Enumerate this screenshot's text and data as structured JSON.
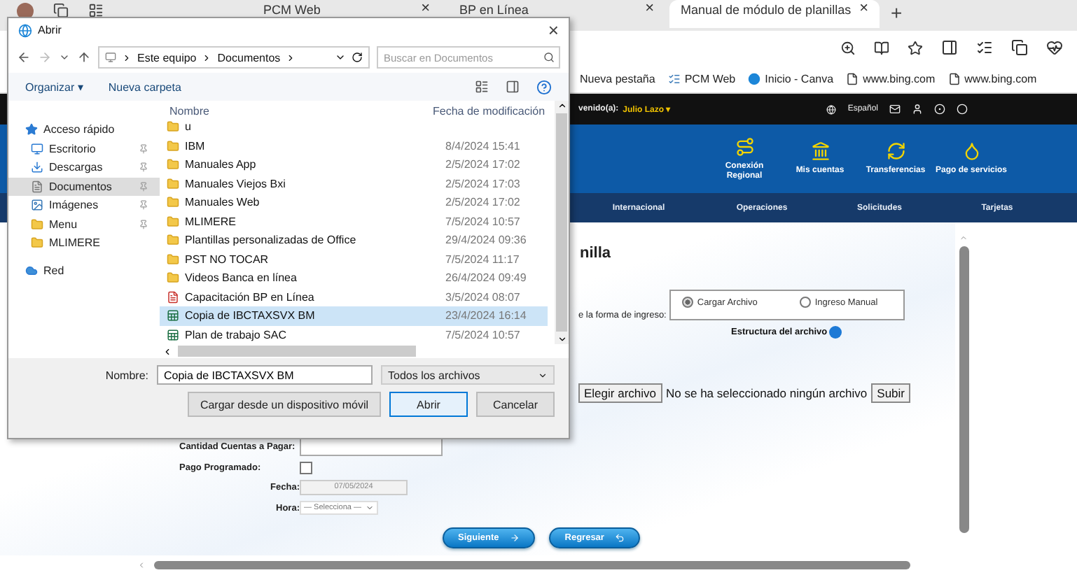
{
  "browser": {
    "tabs": [
      {
        "label": "PCM Web",
        "close": "×",
        "selected": false
      },
      {
        "label": "BP en Línea",
        "close": "×",
        "selected": false
      },
      {
        "label": "Manual de módulo de planillas",
        "close": "×",
        "selected": true
      }
    ],
    "new_tab": "+",
    "bookmarks": [
      {
        "label": "Nueva pestaña",
        "kind": "plain"
      },
      {
        "label": "PCM Web",
        "kind": "chart"
      },
      {
        "label": "Inicio - Canva",
        "kind": "round"
      },
      {
        "label": "www.bing.com",
        "kind": "page"
      },
      {
        "label": "www.bing.com",
        "kind": "page"
      }
    ]
  },
  "bank": {
    "welcome": "venido(a):",
    "user": "Julio Lazo ▾",
    "language": "Español",
    "menu": [
      "Conexión Regional",
      "Mis cuentas",
      "Transferencias",
      "Pago de servicios"
    ],
    "nav": [
      "Internacional",
      "Operaciones",
      "Solicitudes",
      "Tarjetas"
    ],
    "title": "nilla",
    "mode_label": "e la forma de ingreso:",
    "modes": [
      {
        "label": "Cargar Archivo",
        "selected": true
      },
      {
        "label": "Ingreso Manual",
        "selected": false
      }
    ],
    "structure_label": "Estructura del archivo",
    "file_button": "Elegir archivo",
    "file_status": "No se ha seleccionado ningún archivo",
    "upload_button": "Subir",
    "fields": [
      {
        "kind": "text",
        "label": "Cantidad Cuentas a Pagar:"
      },
      {
        "kind": "checkbox",
        "label": "Pago Programado:",
        "checked": false
      },
      {
        "kind": "date",
        "label": "Fecha:",
        "value": "07/05/2024",
        "disabled": true
      },
      {
        "kind": "select",
        "label": "Hora:",
        "value": "— Selecciona —"
      }
    ],
    "next_button": "Siguiente",
    "back_button": "Regresar"
  },
  "dialog": {
    "title": "Abrir",
    "close": "×",
    "path": [
      "Este equipo",
      "Documentos"
    ],
    "search_placeholder": "Buscar en Documentos",
    "organize": "Organizar ▾",
    "new_folder": "Nueva carpeta",
    "sidebar": [
      {
        "label": "Acceso rápido",
        "kind": "star",
        "pinned": false,
        "selected": false
      },
      {
        "label": "Escritorio",
        "kind": "desktop",
        "pinned": true,
        "selected": false
      },
      {
        "label": "Descargas",
        "kind": "download",
        "pinned": true,
        "selected": false
      },
      {
        "label": "Documentos",
        "kind": "document",
        "pinned": true,
        "selected": true
      },
      {
        "label": "Imágenes",
        "kind": "image",
        "pinned": true,
        "selected": false
      },
      {
        "label": "Menu",
        "kind": "folder",
        "pinned": true,
        "selected": false
      },
      {
        "label": "MLIMERE",
        "kind": "folder",
        "pinned": false,
        "selected": false
      },
      {
        "label": "Red",
        "kind": "network",
        "pinned": false,
        "selected": false
      }
    ],
    "columns": [
      "Nombre",
      "Fecha de modificación"
    ],
    "files": [
      {
        "name": "u",
        "kind": "folder",
        "selected": false
      },
      {
        "name": "IBM",
        "date": "8/4/2024 15:41",
        "kind": "folder",
        "selected": false
      },
      {
        "name": "Manuales App",
        "date": "2/5/2024 17:02",
        "kind": "folder",
        "selected": false
      },
      {
        "name": "Manuales Viejos Bxi",
        "date": "2/5/2024 17:03",
        "kind": "folder",
        "selected": false
      },
      {
        "name": "Manuales Web",
        "date": "2/5/2024 17:02",
        "kind": "folder",
        "selected": false
      },
      {
        "name": "MLIMERE",
        "date": "7/5/2024 10:57",
        "kind": "folder",
        "selected": false
      },
      {
        "name": "Plantillas personalizadas de Office",
        "date": "29/4/2024 09:36",
        "kind": "folder",
        "selected": false
      },
      {
        "name": "PST NO TOCAR",
        "date": "7/5/2024 11:17",
        "kind": "folder",
        "selected": false
      },
      {
        "name": "Videos Banca en línea",
        "date": "26/4/2024 09:49",
        "kind": "folder",
        "selected": false
      },
      {
        "name": "Capacitación BP en Línea",
        "date": "3/5/2024 08:07",
        "kind": "pdf",
        "selected": false
      },
      {
        "name": "Copia de IBCTAXSVX BM",
        "date": "23/4/2024 16:14",
        "kind": "sheet",
        "selected": true
      },
      {
        "name": "Plan de trabajo SAC",
        "date": "7/5/2024 10:57",
        "kind": "sheet",
        "selected": false
      }
    ],
    "name_label": "Nombre:",
    "name_value": "Copia de IBCTAXSVX BM",
    "filter": "Todos los archivos",
    "buttons": [
      {
        "label": "Cargar desde un dispositivo móvil",
        "kind": "secondary"
      },
      {
        "label": "Abrir",
        "kind": "primary"
      },
      {
        "label": "Cancelar",
        "kind": "secondary"
      }
    ]
  }
}
